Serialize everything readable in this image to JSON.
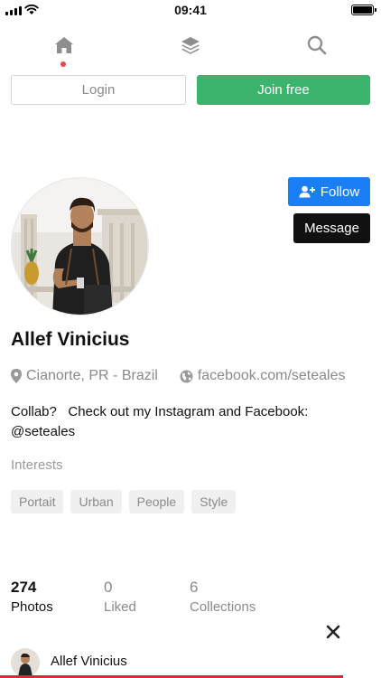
{
  "status_bar": {
    "time": "09:41"
  },
  "nav": {
    "items": [
      {
        "icon": "home-icon",
        "active": true
      },
      {
        "icon": "layers-icon",
        "active": false
      },
      {
        "icon": "search-icon",
        "active": false
      }
    ]
  },
  "auth": {
    "login_label": "Login",
    "join_label": "Join free"
  },
  "profile": {
    "name": "Allef Vinicius",
    "location": "Cianorte, PR - Brazil",
    "website": "facebook.com/seteales",
    "bio_line1": "Collab?   Check out my Instagram and Facebook:",
    "bio_line2": "@seteales",
    "follow_label": "Follow",
    "message_label": "Message"
  },
  "interests": {
    "label": "Interests",
    "tags": [
      "Portait",
      "Urban",
      "People",
      "Style"
    ]
  },
  "stats": [
    {
      "value": "274",
      "label": "Photos"
    },
    {
      "value": "0",
      "label": "Liked"
    },
    {
      "value": "6",
      "label": "Collections"
    }
  ],
  "bottom_bar": {
    "name": "Allef Vinicius"
  },
  "colors": {
    "accent_green": "#3cb46e",
    "accent_blue": "#1a7ef5",
    "active_dot": "#e8474f",
    "progress_red": "#e02534"
  }
}
